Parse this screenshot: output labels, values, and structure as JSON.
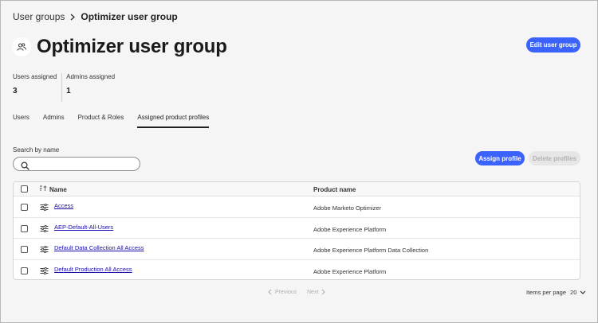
{
  "breadcrumb": {
    "parent": "User groups",
    "current": "Optimizer user group"
  },
  "page": {
    "title": "Optimizer user group"
  },
  "header": {
    "edit_label": "Edit user group"
  },
  "stats": [
    {
      "label": "Users assigned",
      "value": "3"
    },
    {
      "label": "Admins assigned",
      "value": "1"
    }
  ],
  "tabs": [
    {
      "label": "Users",
      "active": false
    },
    {
      "label": "Admins",
      "active": false
    },
    {
      "label": "Product & Roles",
      "active": false
    },
    {
      "label": "Assigned product profiles",
      "active": true
    }
  ],
  "search": {
    "label": "Search by name",
    "value": "",
    "placeholder": ""
  },
  "actions": {
    "assign_label": "Assign profile",
    "delete_label": "Delete profiles"
  },
  "table": {
    "columns": {
      "name": "Name",
      "product": "Product name"
    },
    "rows": [
      {
        "name": "Access",
        "product": "Adobe Marketo Optimizer"
      },
      {
        "name": "AEP-Default-All-Users",
        "product": "Adobe Experience Platform"
      },
      {
        "name": "Default Data Collection All Access",
        "product": "Adobe Experience Platform Data Collection"
      },
      {
        "name": "Default Production All Access",
        "product": "Adobe Experience Platform"
      }
    ]
  },
  "pagination": {
    "previous_label": "Previous",
    "next_label": "Next",
    "items_per_page_label": "Items per page",
    "items_per_page_value": "20"
  },
  "colors": {
    "accent": "#3b63fb",
    "link": "#1a0dab",
    "disabled_bg": "#e6e6e6",
    "disabled_text": "#b1b1b1"
  },
  "icons": {
    "breadcrumb_separator": "chevron-right-icon",
    "avatar": "user-group-icon",
    "search": "search-icon",
    "sort": "sort-icon",
    "row": "adjust-icon",
    "pager_prev": "chevron-left-icon",
    "pager_next": "chevron-right-icon",
    "dropdown": "chevron-down-icon"
  }
}
